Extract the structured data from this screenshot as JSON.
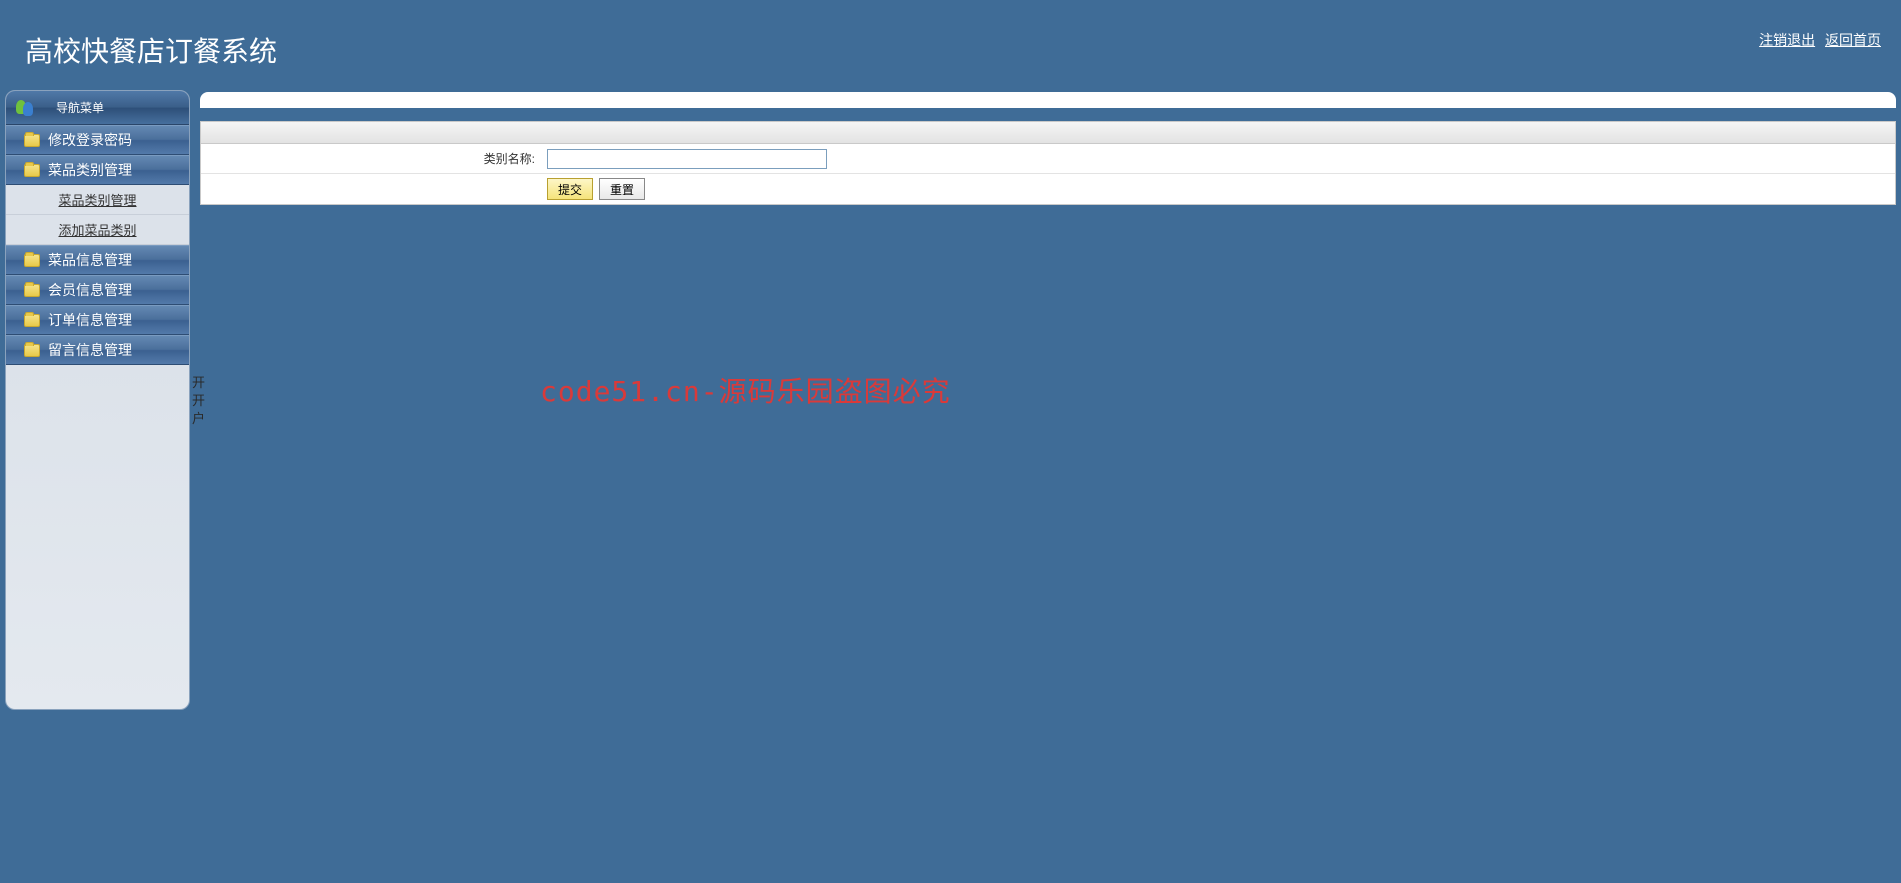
{
  "header": {
    "title": "高校快餐店订餐系统",
    "logout_link": "注销退出",
    "home_link": "返回首页"
  },
  "sidebar": {
    "header_label": "导航菜单",
    "items": [
      {
        "label": "修改登录密码"
      },
      {
        "label": "菜品类别管理",
        "children": [
          {
            "label": "菜品类别管理"
          },
          {
            "label": "添加菜品类别"
          }
        ]
      },
      {
        "label": "菜品信息管理"
      },
      {
        "label": "会员信息管理"
      },
      {
        "label": "订单信息管理"
      },
      {
        "label": "留言信息管理"
      }
    ]
  },
  "form": {
    "category_name_label": "类别名称:",
    "category_name_value": "",
    "submit_label": "提交",
    "reset_label": "重置"
  },
  "watermark": "code51.cn-源码乐园盗图必究",
  "stray": {
    "a": "开",
    "b": "开",
    "c": "户"
  }
}
